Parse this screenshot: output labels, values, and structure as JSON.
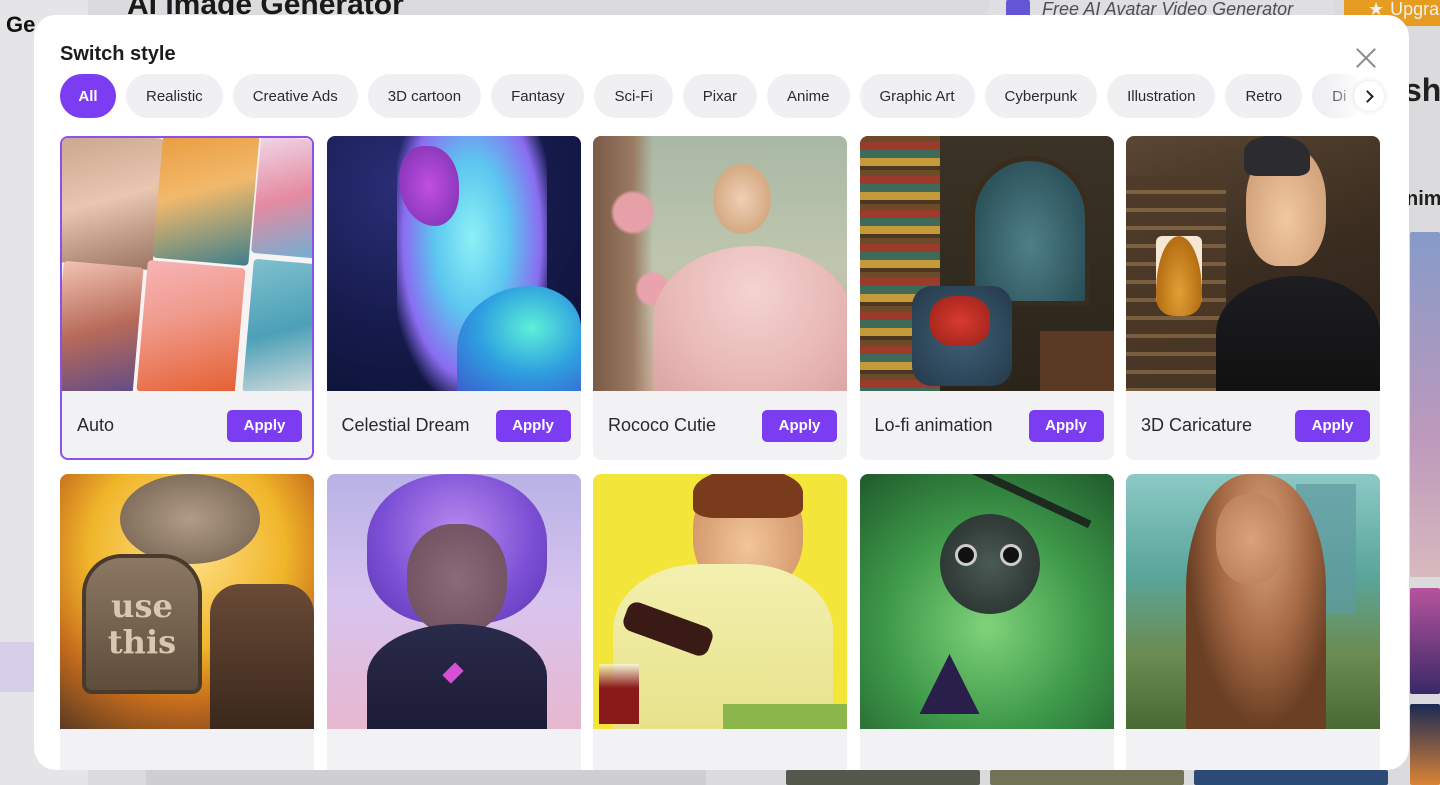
{
  "background": {
    "brand_partial": "Ge",
    "page_title_partial": "AI Image Generator",
    "promo_label": "Free AI Avatar Video Generator",
    "upgrade_label": "Upgra",
    "side_heading_partial": "sh",
    "side_subheading_partial": "nim"
  },
  "modal": {
    "title": "Switch style",
    "tabs": [
      {
        "label": "All",
        "active": true
      },
      {
        "label": "Realistic"
      },
      {
        "label": "Creative Ads"
      },
      {
        "label": "3D cartoon"
      },
      {
        "label": "Fantasy"
      },
      {
        "label": "Sci-Fi"
      },
      {
        "label": "Pixar"
      },
      {
        "label": "Anime"
      },
      {
        "label": "Graphic Art"
      },
      {
        "label": "Cyberpunk"
      },
      {
        "label": "Illustration"
      },
      {
        "label": "Retro"
      },
      {
        "label": "Di"
      }
    ],
    "apply_label": "Apply",
    "styles": [
      {
        "name": "Auto",
        "selected": true
      },
      {
        "name": "Celestial Dream"
      },
      {
        "name": "Rococo Cutie"
      },
      {
        "name": "Lo-fi animation"
      },
      {
        "name": "3D Caricature"
      },
      {
        "name": ""
      },
      {
        "name": ""
      },
      {
        "name": ""
      },
      {
        "name": ""
      },
      {
        "name": ""
      }
    ],
    "image_overlay_text": {
      "sign_line1": "use",
      "sign_line2": "this"
    }
  },
  "colors": {
    "accent": "#7b3cf2",
    "tab_bg": "#f0f0f3",
    "card_bg": "#f2f2f5"
  },
  "icons": {
    "close": "close-icon",
    "next": "chevron-right-icon"
  }
}
